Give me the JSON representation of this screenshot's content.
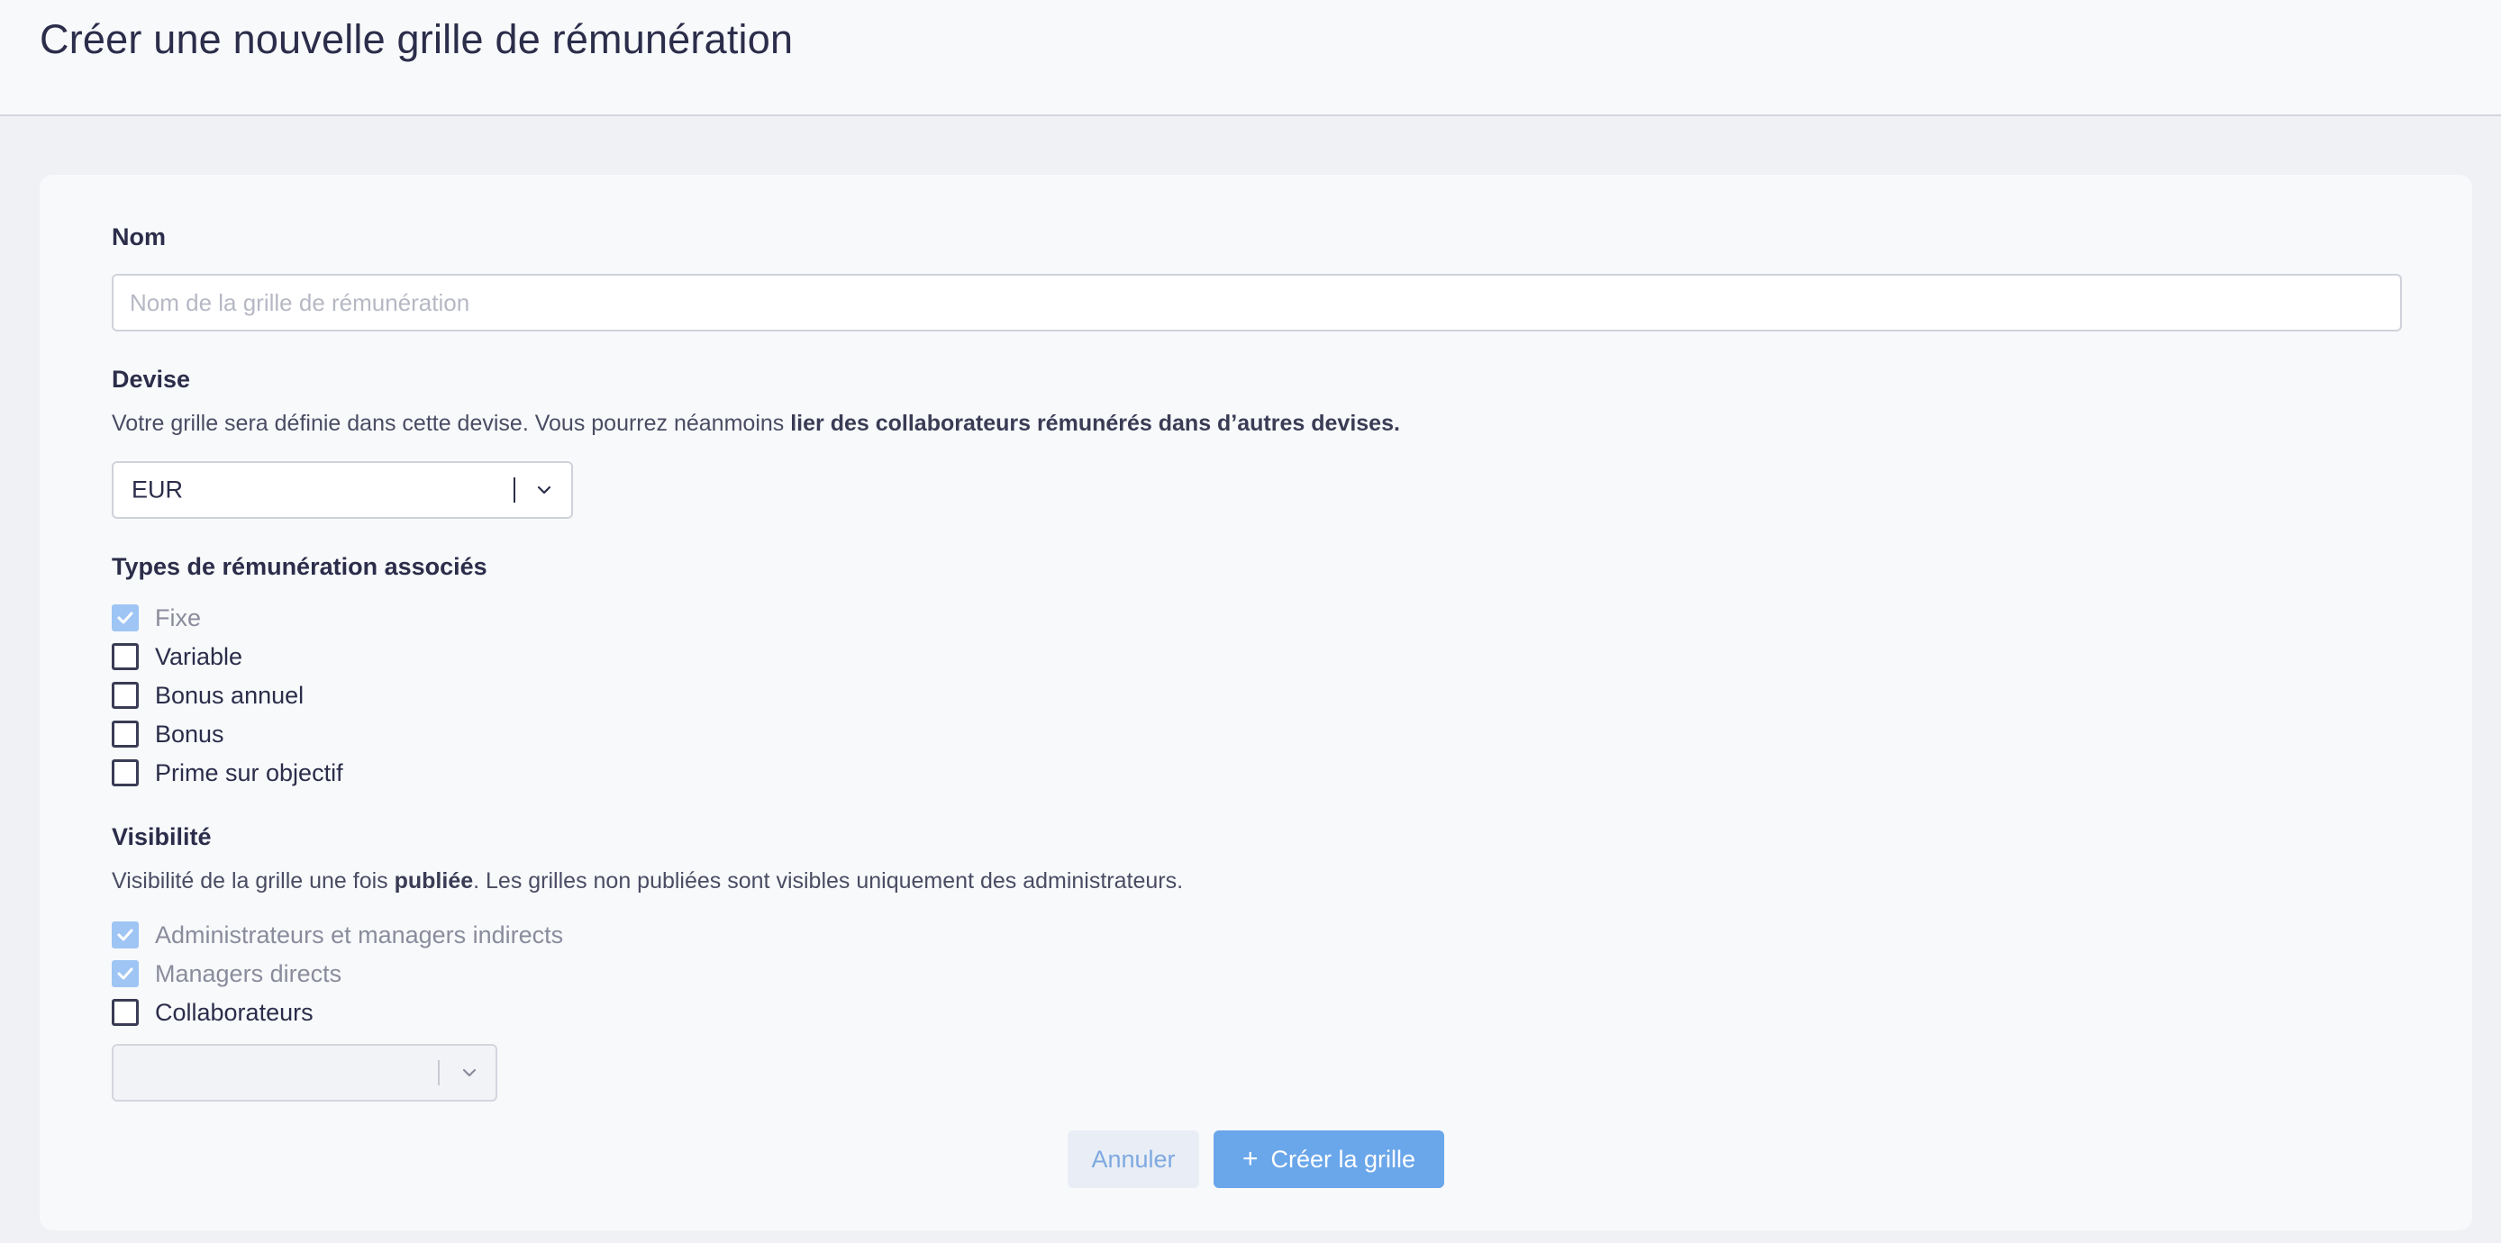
{
  "header": {
    "title": "Créer une nouvelle grille de rémunération"
  },
  "form": {
    "name": {
      "label": "Nom",
      "placeholder": "Nom de la grille de rémunération",
      "value": ""
    },
    "currency": {
      "label": "Devise",
      "helper_prefix": "Votre grille sera définie dans cette devise. Vous pourrez néanmoins ",
      "helper_bold": "lier des collaborateurs rémunérés dans d’autres devises.",
      "selected": "EUR"
    },
    "types": {
      "label": "Types de rémunération associés",
      "options": [
        {
          "label": "Fixe",
          "checked": true,
          "disabled": true
        },
        {
          "label": "Variable",
          "checked": false,
          "disabled": false
        },
        {
          "label": "Bonus annuel",
          "checked": false,
          "disabled": false
        },
        {
          "label": "Bonus",
          "checked": false,
          "disabled": false
        },
        {
          "label": "Prime sur objectif",
          "checked": false,
          "disabled": false
        }
      ]
    },
    "visibility": {
      "label": "Visibilité",
      "helper_prefix": "Visibilité de la grille une fois ",
      "helper_bold": "publiée",
      "helper_suffix": ". Les grilles non publiées sont visibles uniquement des administrateurs.",
      "options": [
        {
          "label": "Administrateurs et managers indirects",
          "checked": true,
          "disabled": true
        },
        {
          "label": "Managers directs",
          "checked": true,
          "disabled": true
        },
        {
          "label": "Collaborateurs",
          "checked": false,
          "disabled": false
        }
      ],
      "collaborators_select_value": ""
    }
  },
  "actions": {
    "cancel_label": "Annuler",
    "create_label": "Créer la grille",
    "create_icon": "plus-icon"
  },
  "colors": {
    "primary": "#6aa6ea",
    "cancel_text": "#7fa9e0",
    "checked_disabled": "#9fc5f4",
    "text": "#2b2d4a"
  }
}
